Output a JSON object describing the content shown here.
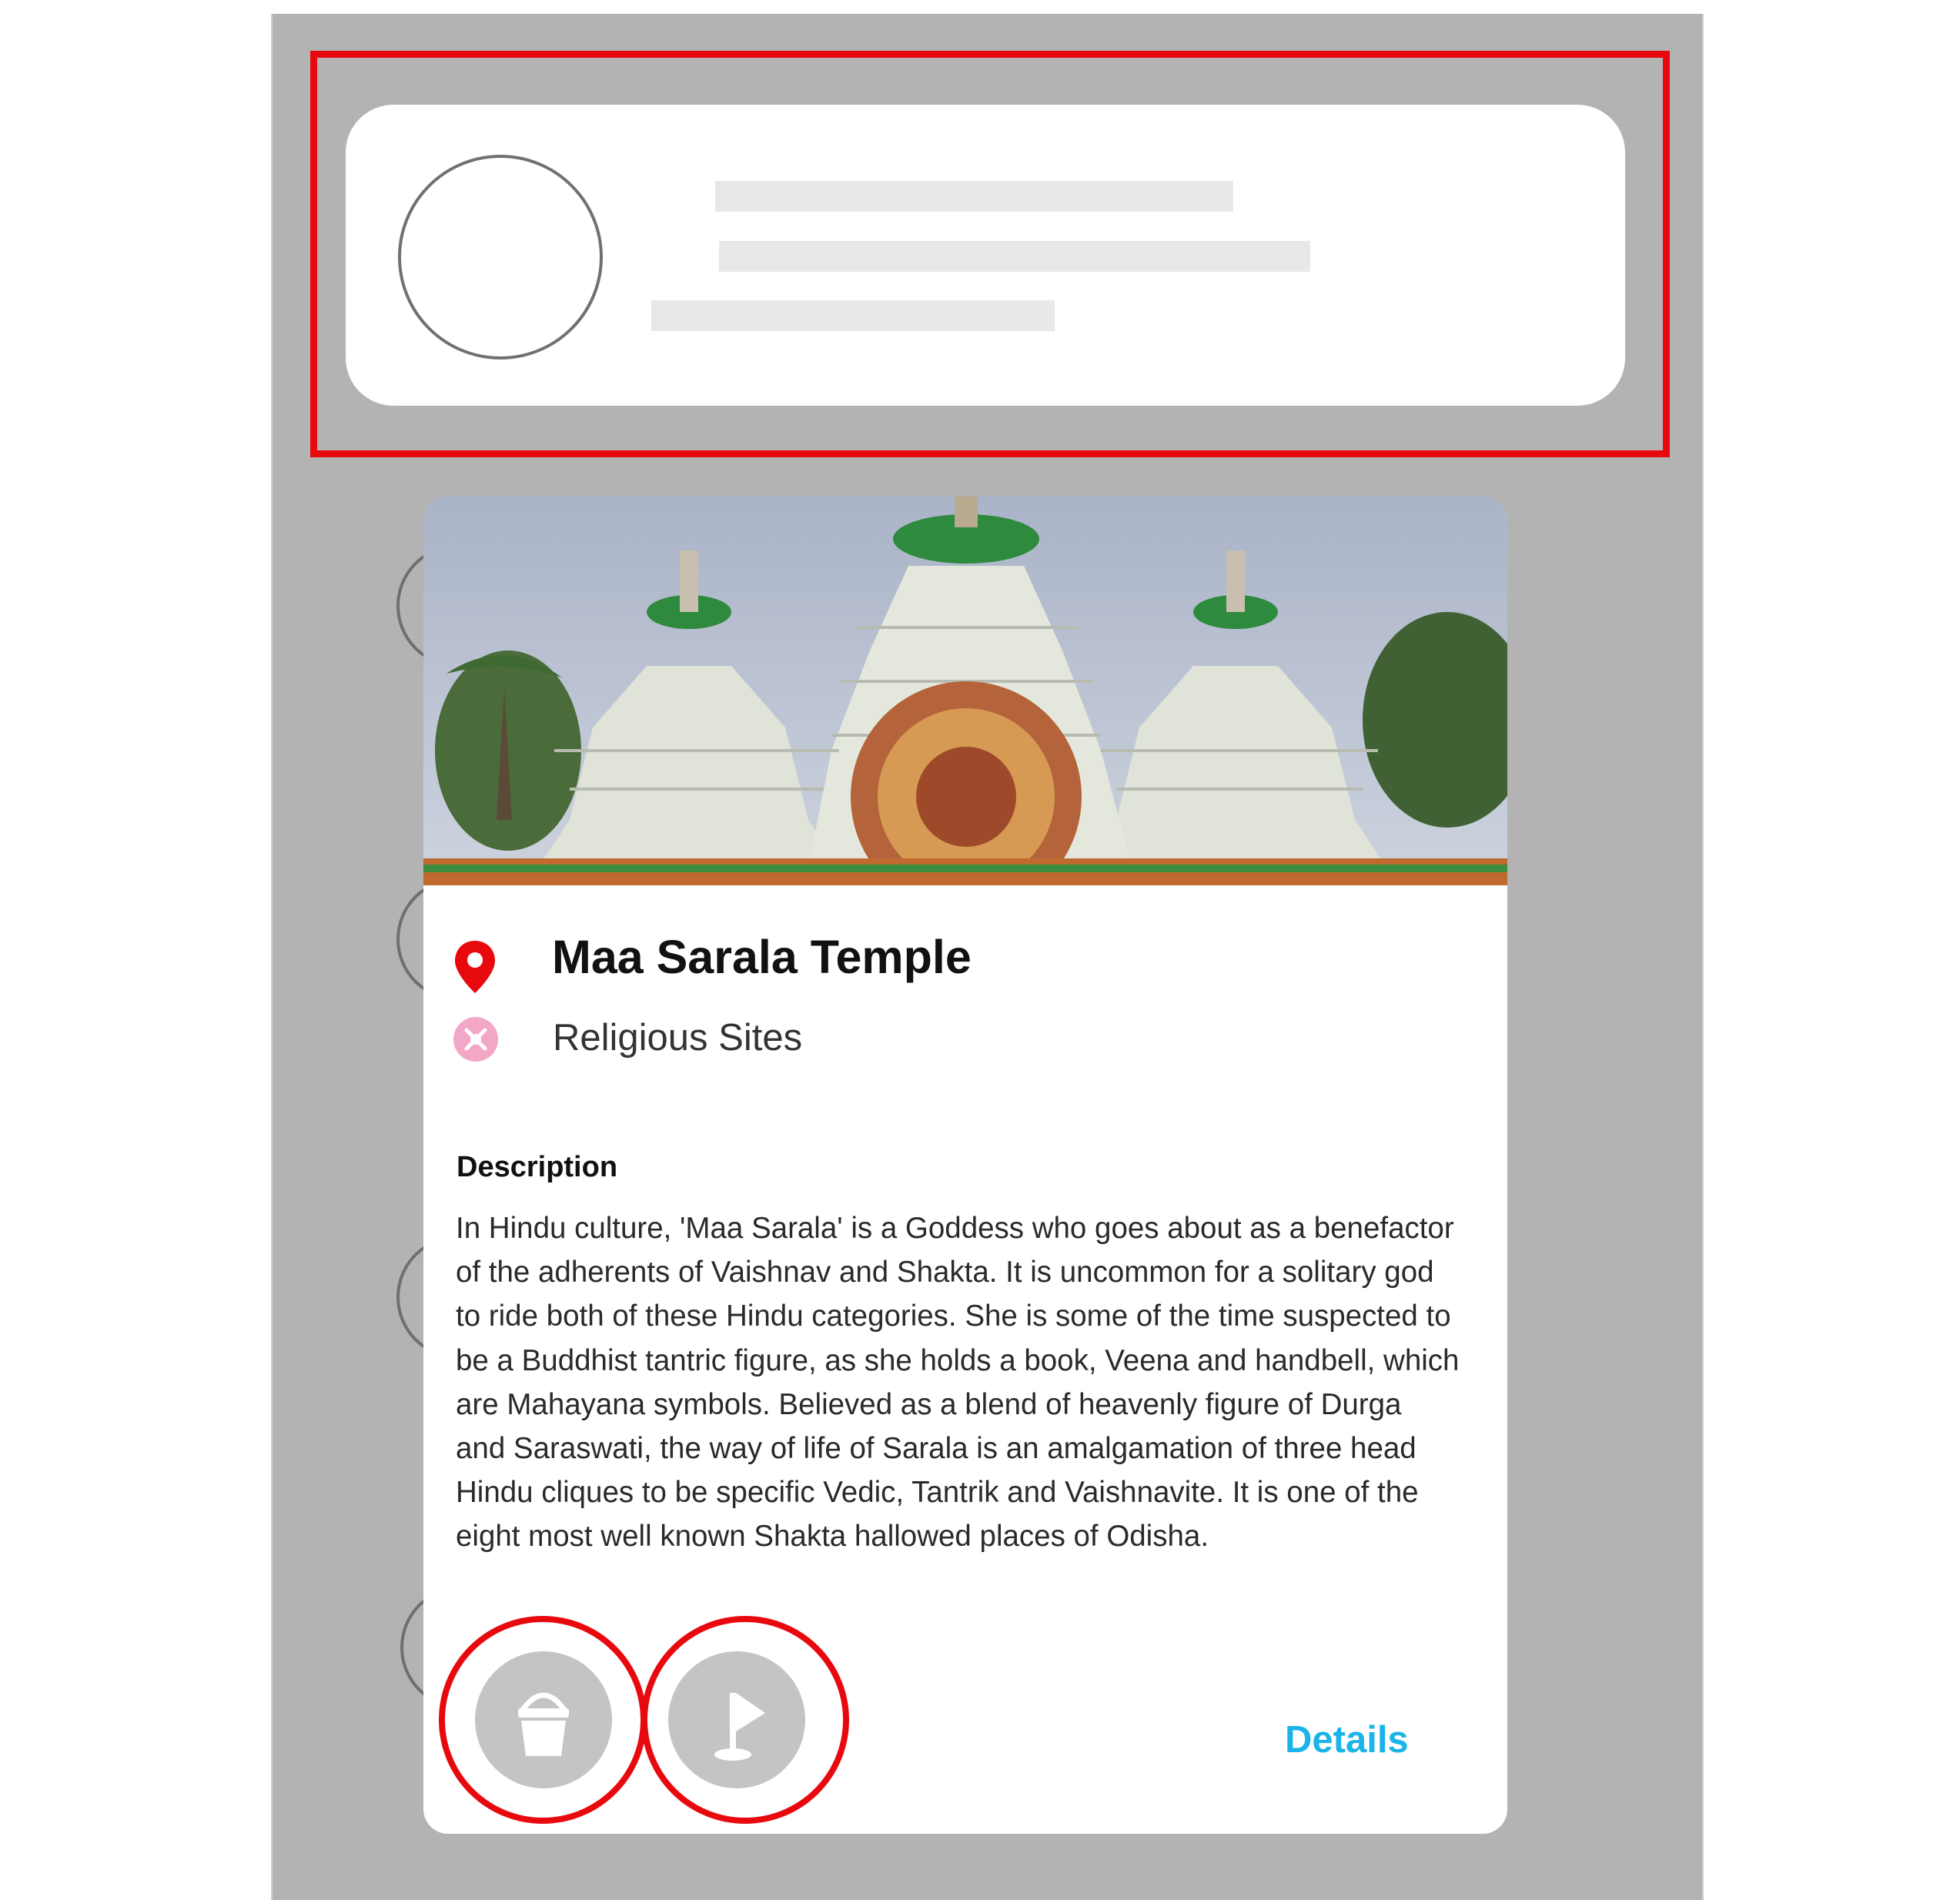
{
  "place": {
    "title": "Maa Sarala Temple",
    "category": "Religious Sites"
  },
  "description": {
    "heading": "Description",
    "lines": [
      "In Hindu culture, 'Maa Sarala' is a Goddess who goes about as a benefactor",
      "of the adherents of Vaishnav and Shakta. It is uncommon for a solitary god",
      "to ride both of these Hindu categories. She is some of the time suspected to",
      "be a Buddhist tantric figure, as she holds a book, Veena and handbell, which",
      "are Mahayana symbols. Believed as a blend of heavenly figure of Durga",
      "and Saraswati, the way of life of Sarala is an amalgamation of three head",
      "Hindu cliques to be specific Vedic, Tantrik and Vaishnavite. It is one of the",
      "eight most well known Shakta hallowed places of Odisha."
    ]
  },
  "actions": {
    "details_label": "Details",
    "bucket_icon": "bucket-icon",
    "flag_icon": "flag-icon"
  },
  "colors": {
    "highlight": "#e8090f",
    "link": "#1ab4e8",
    "pin": "#e8090f",
    "action_bg": "#c4c4c4",
    "background": "#b3b3b3"
  }
}
